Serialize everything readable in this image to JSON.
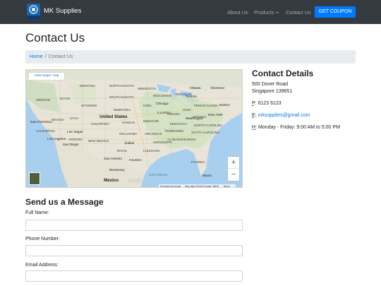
{
  "navbar": {
    "brand_name": "MK Supplies",
    "links": {
      "about": "About Us",
      "products": "Products",
      "contact": "Contact Us"
    },
    "coupon_button": "GET COUPON"
  },
  "page": {
    "title": "Contact Us"
  },
  "breadcrumb": {
    "home": "Home",
    "separator": "/",
    "current": "Contact Us"
  },
  "map": {
    "view_larger": "View larger map",
    "zoom_in": "+",
    "zoom_out": "−",
    "google": "Google",
    "attribution": {
      "shortcuts": "Keyboard shortcuts",
      "data": "Map data ©2023 Google, INEGI",
      "terms": "Terms"
    },
    "labels": {
      "united_states": "United States",
      "mexico": "Mexico",
      "gulf": "Gulf of Mexico",
      "ottawa": "Ottawa",
      "montreal": "Montreal",
      "toronto": "Toronto",
      "chicago": "Chicago",
      "boston": "Boston",
      "new_york": "New York",
      "washington": "Washington",
      "san_francisco": "San Francisco",
      "las_vegas": "Las Vegas",
      "los_angeles": "Los Angeles",
      "san_diego": "San Diego",
      "dallas": "Dallas",
      "san_antonio": "San Antonio",
      "houston": "Houston",
      "monterrey": "Monterrey",
      "miami": "Miami",
      "oregon": "OREGON",
      "idaho": "IDAHO",
      "montana": "MONTANA",
      "wyoming": "WYOMING",
      "nevada": "NEVADA",
      "utah": "UTAH",
      "colorado": "COLORADO",
      "california": "CALIFORNIA",
      "arizona": "ARIZONA",
      "new_mexico": "NEW MEXICO",
      "texas": "TEXAS",
      "north_dakota": "NORTH DAKOTA",
      "south_dakota": "SOUTH DAKOTA",
      "nebraska": "NEBRASKA",
      "kansas": "KANSAS",
      "oklahoma": "OKLAHOMA",
      "minnesota": "MINNESOTA",
      "iowa": "IOWA",
      "missouri": "MISSOURI",
      "illinois": "ILLINOIS",
      "wisconsin": "WISCONSIN",
      "michigan": "MICHIGAN",
      "indiana": "INDIANA",
      "ohio": "OHIO",
      "kentucky": "KENTUCKY",
      "tennessee": "TENNESSEE",
      "arkansas": "ARKANSAS",
      "mississippi": "MISSISSIPPI",
      "alabama": "ALABAMA",
      "georgia": "GEORGIA",
      "louisiana": "LOUISIANA",
      "florida": "FLORIDA",
      "south_carolina": "SOUTH CAROLINA",
      "north_carolina": "NORTH CAROLINA",
      "virginia": "VIRGINIA",
      "pennsylvania": "PENNSYLVANIA"
    }
  },
  "contact_details": {
    "title": "Contact Details",
    "address_line1": "500 Dover Road",
    "address_line2": "Singapore 139651",
    "phone_abbr": "P",
    "phone": "6123 6123",
    "email_abbr": "E",
    "email": "mksupplies@gmail.com",
    "hours_abbr": "H",
    "hours": "Monday - Friday: 9:00 AM to 5:00 PM"
  },
  "form": {
    "title": "Send us a Message",
    "name_label": "Full Name:",
    "phone_label": "Phone Number:",
    "email_label": "Email Address:"
  },
  "colors": {
    "navbar_bg": "#343a40",
    "primary": "#007bff",
    "breadcrumb_bg": "#e9ecef",
    "water": "#a9cfee",
    "land": "#e8e5d8"
  }
}
